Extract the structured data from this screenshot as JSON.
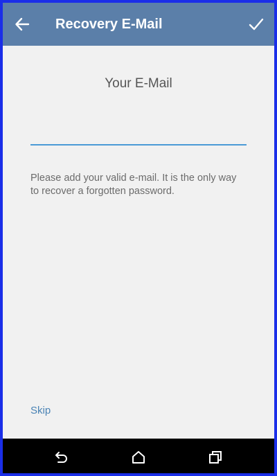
{
  "toolbar": {
    "title": "Recovery E-Mail",
    "back_icon": "arrow-left-icon",
    "confirm_icon": "checkmark-icon",
    "background": "#5b7fa9"
  },
  "main": {
    "heading": "Your E-Mail",
    "email_value": "",
    "helper_text": "Please add your valid e-mail. It is the only way to recover a forgotten password.",
    "skip_label": "Skip",
    "accent": "#4a9ad6"
  },
  "navbar": {
    "back_icon": "nav-back-icon",
    "home_icon": "nav-home-icon",
    "recents_icon": "nav-recents-icon"
  },
  "frame_color": "#1a2ee8"
}
